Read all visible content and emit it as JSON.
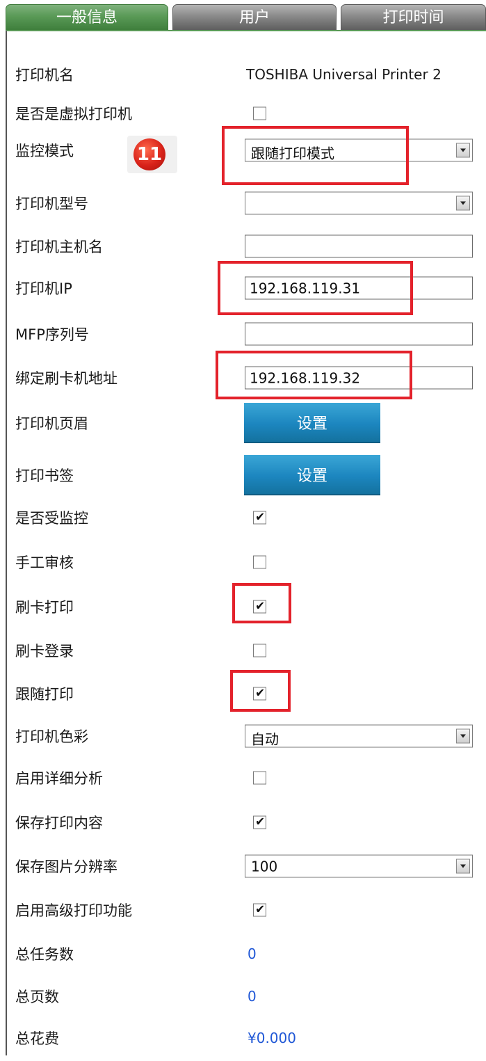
{
  "tabs": [
    {
      "label": "一般信息"
    },
    {
      "label": "用户"
    },
    {
      "label": "打印时间"
    }
  ],
  "fields": {
    "printer_name": {
      "label": "打印机名",
      "value": "TOSHIBA Universal Printer 2"
    },
    "is_virtual": {
      "label": "是否是虚拟打印机",
      "checked": false
    },
    "monitor_mode": {
      "label": "监控模式",
      "selected": "跟随打印模式"
    },
    "printer_model": {
      "label": "打印机型号",
      "selected": ""
    },
    "printer_host": {
      "label": "打印机主机名",
      "value": ""
    },
    "printer_ip": {
      "label": "打印机IP",
      "value": "192.168.119.31"
    },
    "mfp_serial": {
      "label": "MFP序列号",
      "value": ""
    },
    "card_reader_addr": {
      "label": "绑定刷卡机地址",
      "value": "192.168.119.32"
    },
    "printer_header": {
      "label": "打印机页眉",
      "button": "设置"
    },
    "print_bookmark": {
      "label": "打印书签",
      "button": "设置"
    },
    "is_monitored": {
      "label": "是否受监控",
      "checked": true
    },
    "manual_review": {
      "label": "手工审核",
      "checked": false
    },
    "card_print": {
      "label": "刷卡打印",
      "checked": true
    },
    "card_login": {
      "label": "刷卡登录",
      "checked": false
    },
    "follow_print": {
      "label": "跟随打印",
      "checked": true
    },
    "printer_color": {
      "label": "打印机色彩",
      "selected": "自动"
    },
    "detailed_analysis": {
      "label": "启用详细分析",
      "checked": false
    },
    "save_content": {
      "label": "保存打印内容",
      "checked": true
    },
    "image_resolution": {
      "label": "保存图片分辨率",
      "selected": "100"
    },
    "advanced_print": {
      "label": "启用高级打印功能",
      "checked": true
    },
    "total_jobs": {
      "label": "总任务数",
      "value": "0"
    },
    "total_pages": {
      "label": "总页数",
      "value": "0"
    },
    "total_cost": {
      "label": "总花费",
      "value": "¥0.000"
    }
  },
  "badge": {
    "number": "11"
  },
  "colors": {
    "active_tab": "#5a9a57",
    "inactive_tab": "#8a8a8a",
    "button": "#1c86bf",
    "highlight": "#e3222b",
    "stat_value": "#1f57d6"
  }
}
